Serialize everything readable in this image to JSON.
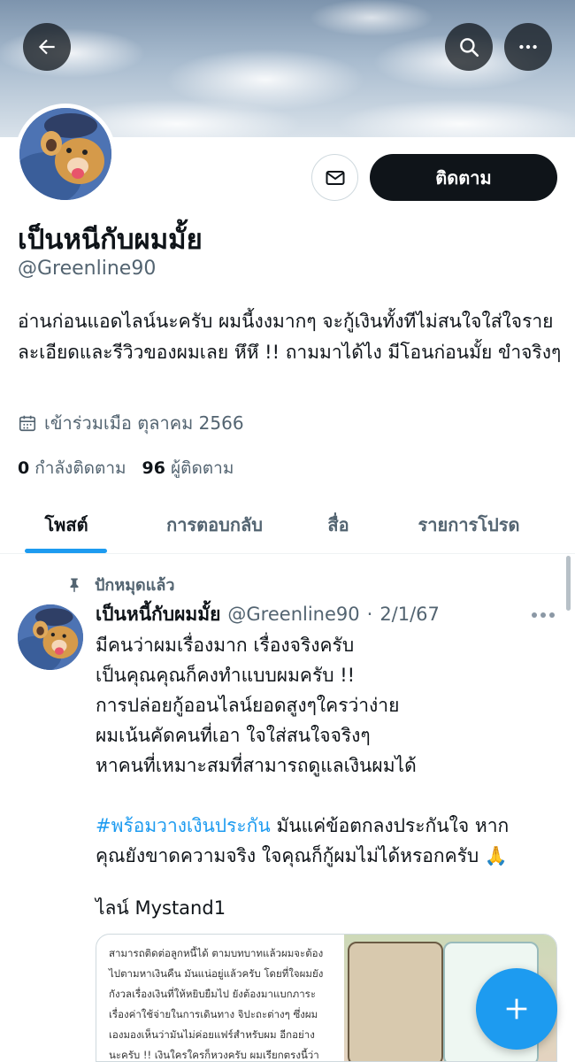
{
  "header": {
    "back_icon": "arrow-left-icon",
    "search_icon": "search-icon",
    "more_icon": "more-horizontal-icon"
  },
  "profile": {
    "display_name": "เป็นหนีกับผมมั้ย",
    "handle": "@Greenline90",
    "bio": "อ่านก่อนแอดไลน์นะครับ ผมนี้งงมากๆ จะกู้เงินทั้งทีไม่สนใจใส่ใจรายละเอียดและรีวิวของผมเลย หึหึ !! ถามมาได้ไง มีโอนก่อนมั้ย ขำจริงๆ",
    "joined": "เข้าร่วมเมือ ตุลาคม 2566",
    "following_count": "0",
    "following_label": "กำลังติดตาม",
    "followers_count": "96",
    "followers_label": "ผู้ติดตาม",
    "follow_label": "ติดตาม",
    "message_icon": "mail-icon"
  },
  "tabs": [
    {
      "label": "โพสต์",
      "active": true
    },
    {
      "label": "การตอบกลับ",
      "active": false
    },
    {
      "label": "สื่อ",
      "active": false
    },
    {
      "label": "รายการโปรด",
      "active": false
    }
  ],
  "tweet": {
    "pinned_label": "ปักหมุดแล้ว",
    "author_name": "เป็นหนี้กับผมมั้ย",
    "author_handle": "@Greenline90",
    "separator": "·",
    "date": "2/1/67",
    "lines": [
      "มีคนว่าผมเรื่องมาก เรื่องจริงครับ",
      "เป็นคุณคุณก็คงทำแบบผมครับ !!",
      "การปล่อยกู้ออนไลน์ยอดสูงๆใครว่าง่าย",
      "ผมเน้นคัดคนที่เอา ใจใส่สนใจจริงๆ",
      "หาคนที่เหมาะสมที่สามารถดูแลเงินผมได้"
    ],
    "hashtag": "#พร้อมวางเงินประกัน",
    "hashtag_tail": " มันแค่ข้อตกลงประกันใจ หาก",
    "line7": "คุณยังขาดความจริง ใจคุณก็กู้ผมไม่ได้หรอกครับ 🙏",
    "line_id": "ไลน์ Mystand1",
    "media_text": [
      "สามารถติดต่อลูกหนี้ได้ ตามบทบาทแล้วผมจะต้อง",
      "ไปตามหาเงินคืน มันแน่อยู่แล้วครับ โดยที่ใจผมยัง",
      "กังวลเรื่องเงินที่ให้หยิบยืมไป ยังต้องมาแบกภาระ",
      "เรื่องค่าใช้จ่ายในการเดินทาง จิปะถะต่างๆ ซึ่งผม",
      "เองมองเห็นว่ามันไม่ค่อยแฟร์สำหรับผม อีกอย่าง",
      "นะครับ !! เงินใครใครก็หวงครับ ผมเรียกตรงนี้ว่า"
    ]
  },
  "compose_icon": "plus-icon",
  "colors": {
    "accent": "#1d9bf0",
    "text": "#0f1419",
    "muted": "#536471"
  }
}
